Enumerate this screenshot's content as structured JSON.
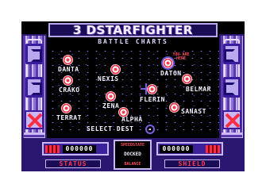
{
  "game": {
    "title": "3 DSTARFIGHTER",
    "subtitle": "BATTLE CHARTS",
    "prompt": "SELECT DEST",
    "planets": [
      {
        "name": "DANTA",
        "current": false
      },
      {
        "name": "NEXIS",
        "current": false
      },
      {
        "name": "DATON",
        "current": true,
        "tag": "YOU ARE HERE"
      },
      {
        "name": "BELMAR",
        "current": false
      },
      {
        "name": "CRAKO",
        "current": false
      },
      {
        "name": "ZENA",
        "current": false
      },
      {
        "name": "FLERIN",
        "current": false
      },
      {
        "name": "SANAST",
        "current": false
      },
      {
        "name": "ALPHA",
        "current": false
      },
      {
        "name": "TERRAT",
        "current": false
      }
    ],
    "status": {
      "label": "STATUS",
      "value": "000000"
    },
    "shield": {
      "label": "SHIELD",
      "value": "000000"
    },
    "center_panel": {
      "top": "SPEEDSTATE",
      "middle": "DOCKED",
      "bottom": "BALANCE"
    }
  },
  "colors": {
    "frame": "#5a3aa8",
    "frame_light": "#c9b8f5",
    "planet_red": "#ff2d44",
    "text": "#f4f0ff",
    "label_red": "#ff3b4e"
  }
}
